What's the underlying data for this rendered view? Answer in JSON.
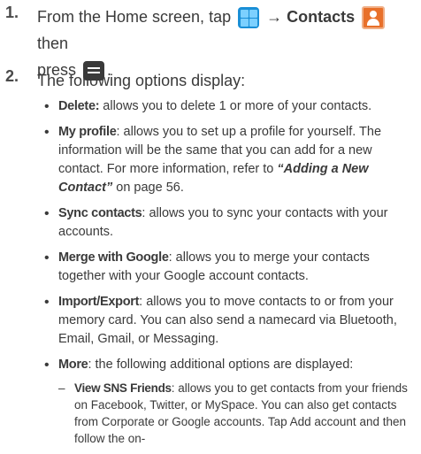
{
  "steps": [
    {
      "number": "1.",
      "text_a": "From the Home screen, tap ",
      "arrow": " → ",
      "bold_contacts": "Contacts",
      "text_then": " then",
      "text_press": "press ",
      "text_end": "."
    },
    {
      "number": "2.",
      "text": "The following options display:"
    }
  ],
  "icons": {
    "apps": "apps-grid-icon",
    "contacts": "contacts-app-icon",
    "menu": "menu-key-icon"
  },
  "options": [
    {
      "term": "Delete:",
      "desc": " allows you to delete 1 or more of your contacts."
    },
    {
      "term": "My profile",
      "desc": ": allows you to set up a profile for yourself. The information will be the same that you can add for a new contact. For more information, refer to ",
      "ref": "“Adding a New Contact”",
      "desc_after": "  on page 56."
    },
    {
      "term": "Sync contacts",
      "desc": ": allows you to sync your contacts with your accounts."
    },
    {
      "term": "Merge with Google",
      "desc": ": allows you to merge your contacts together with your Google account contacts."
    },
    {
      "term": "Import/Export",
      "desc": ": allows you to move contacts to or from your memory card. You can also send a namecard via Bluetooth, Email, Gmail, or Messaging."
    },
    {
      "term": "More",
      "desc": ": the following additional options are displayed:"
    }
  ],
  "sub_options": [
    {
      "term": "View SNS Friends",
      "desc": ": allows you to get contacts from your friends on Facebook, Twitter, or MySpace. You can also get contacts from Corporate or Google accounts. Tap Add account and then follow the on-"
    }
  ]
}
